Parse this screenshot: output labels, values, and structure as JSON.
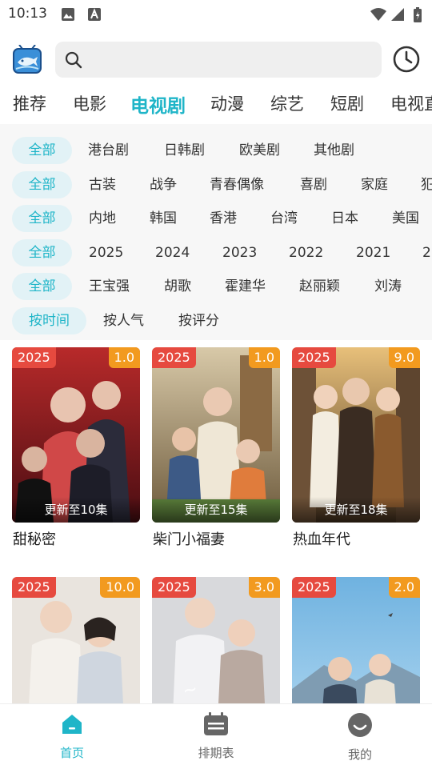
{
  "status_bar": {
    "time": "10:13"
  },
  "header": {
    "search_placeholder": ""
  },
  "tabs": [
    {
      "label": "推荐"
    },
    {
      "label": "电影"
    },
    {
      "label": "电视剧",
      "active": true
    },
    {
      "label": "动漫"
    },
    {
      "label": "综艺"
    },
    {
      "label": "短剧"
    },
    {
      "label": "电视直"
    }
  ],
  "filters": [
    {
      "selected": "全部",
      "options": [
        "港台剧",
        "日韩剧",
        "欧美剧",
        "其他剧"
      ]
    },
    {
      "selected": "全部",
      "options": [
        "古装",
        "战争",
        "青春偶像",
        "喜剧",
        "家庭",
        "犯"
      ]
    },
    {
      "selected": "全部",
      "options": [
        "内地",
        "韩国",
        "香港",
        "台湾",
        "日本",
        "美国"
      ]
    },
    {
      "selected": "全部",
      "options": [
        "2025",
        "2024",
        "2023",
        "2022",
        "2021",
        "2"
      ]
    },
    {
      "selected": "全部",
      "options": [
        "王宝强",
        "胡歌",
        "霍建华",
        "赵丽颖",
        "刘涛"
      ]
    },
    {
      "selected": "按时间",
      "options": [
        "按人气",
        "按评分"
      ]
    }
  ],
  "cards": [
    {
      "year": "2025",
      "score": "1.0",
      "update": "更新至10集",
      "title": "甜秘密"
    },
    {
      "year": "2025",
      "score": "1.0",
      "update": "更新至15集",
      "title": "柴门小福妻"
    },
    {
      "year": "2025",
      "score": "9.0",
      "update": "更新至18集",
      "title": "热血年代"
    },
    {
      "year": "2025",
      "score": "10.0",
      "update": "",
      "title": ""
    },
    {
      "year": "2025",
      "score": "3.0",
      "update": "",
      "title": ""
    },
    {
      "year": "2025",
      "score": "2.0",
      "update": "",
      "title": ""
    }
  ],
  "bottom_nav": [
    {
      "label": "首页",
      "icon": "home-icon",
      "active": true
    },
    {
      "label": "排期表",
      "icon": "schedule-icon"
    },
    {
      "label": "我的",
      "icon": "profile-icon"
    }
  ],
  "colors": {
    "accent": "#1fb5c8",
    "year_badge": "#e64a3f",
    "score_badge": "#f29a1f",
    "chip_selected_bg": "#e2f2f6",
    "filter_bg": "#f7f7f7"
  }
}
